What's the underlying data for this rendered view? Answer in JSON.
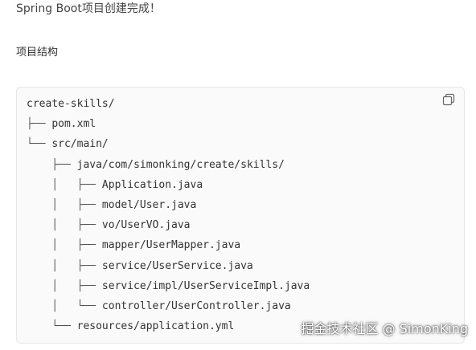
{
  "article": {
    "headline": "Spring Boot项目创建完成！",
    "section_title": "项目结构"
  },
  "code_block": {
    "copy_icon": "copy-icon",
    "lines": [
      {
        "prefix": "",
        "text": "create-skills/"
      },
      {
        "prefix": "├── ",
        "text": "pom.xml"
      },
      {
        "prefix": "└── ",
        "text": "src/main/"
      },
      {
        "prefix": "    ├── ",
        "text": "java/com/simonking/create/skills/"
      },
      {
        "prefix": "    │   ├── ",
        "text": "Application.java"
      },
      {
        "prefix": "    │   ├── ",
        "text": "model/User.java"
      },
      {
        "prefix": "    │   ├── ",
        "text": "vo/UserVO.java"
      },
      {
        "prefix": "    │   ├── ",
        "text": "mapper/UserMapper.java"
      },
      {
        "prefix": "    │   ├── ",
        "text": "service/UserService.java"
      },
      {
        "prefix": "    │   ├── ",
        "text": "service/impl/UserServiceImpl.java"
      },
      {
        "prefix": "    │   └── ",
        "text": "controller/UserController.java"
      },
      {
        "prefix": "    └── ",
        "text": "resources/application.yml"
      }
    ]
  },
  "watermark": "掘金技术社区 @ SimonKing"
}
